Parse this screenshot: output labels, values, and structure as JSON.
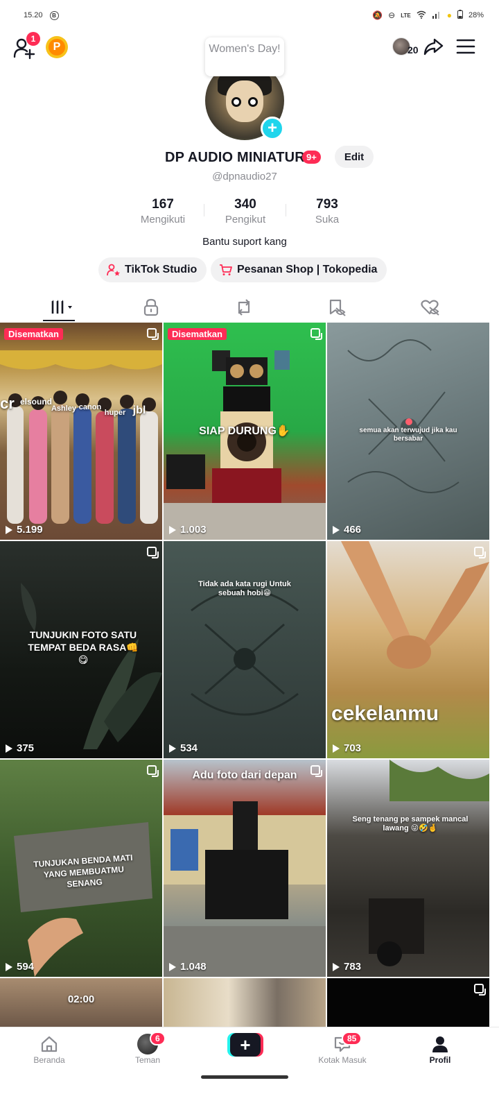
{
  "status_bar": {
    "time": "15.20",
    "carrier_icon": "B",
    "network": "LTE",
    "battery": "28%"
  },
  "top_bar": {
    "notification_count": "1",
    "friends_count": "20"
  },
  "tooltip": {
    "text": "Women's Day!"
  },
  "profile": {
    "name": "DP AUDIO MINIATUR",
    "name_badge": "9+",
    "edit_label": "Edit",
    "username": "@dpnaudio27",
    "bio": "Bantu suport kang"
  },
  "stats": [
    {
      "value": "167",
      "label": "Mengikuti"
    },
    {
      "value": "340",
      "label": "Pengikut"
    },
    {
      "value": "793",
      "label": "Suka"
    }
  ],
  "pills": [
    {
      "label": "TikTok Studio",
      "icon": "person-star-icon"
    },
    {
      "label": "Pesanan Shop | Tokopedia",
      "icon": "cart-icon"
    }
  ],
  "tabs": [
    "videos-grid-icon",
    "lock-icon",
    "repost-icon",
    "bookmark-eye-icon",
    "heart-eye-icon"
  ],
  "videos": [
    {
      "views": "5.199",
      "pinned": "Disematkan",
      "caption": "",
      "bg": "#c0a26b"
    },
    {
      "views": "1.003",
      "pinned": "Disematkan",
      "caption": "SIAP DURUNG✋",
      "bg": "#2fb54a"
    },
    {
      "views": "466",
      "pinned": "",
      "caption": "semua akan terwujud jika kau bersabar",
      "bg": "#6f7e7f"
    },
    {
      "views": "375",
      "pinned": "",
      "caption": "TUNJUKIN FOTO SATU TEMPAT BEDA RASA👊😋",
      "bg": "#1e2420"
    },
    {
      "views": "534",
      "pinned": "",
      "caption": "Tidak ada kata rugi Untuk sebuah hobi😁",
      "bg": "#3c4a48"
    },
    {
      "views": "703",
      "pinned": "",
      "caption": "cekelanmu",
      "bg": "#c9a36a"
    },
    {
      "views": "594",
      "pinned": "",
      "caption": "TUNJUKAN BENDA MATI YANG MEMBUATMU SENANG",
      "bg": "#4d6b35"
    },
    {
      "views": "1.048",
      "pinned": "",
      "caption": "Adu foto dari depan",
      "bg": "#7a8a95"
    },
    {
      "views": "783",
      "pinned": "",
      "caption": "Seng tenang pe sampek mancal lawang 😜🤣🤞",
      "bg": "#3d3a35"
    },
    {
      "views": "",
      "pinned": "",
      "caption": "02:00",
      "bg": "#8a7460"
    },
    {
      "views": "",
      "pinned": "",
      "caption": "",
      "bg": "#b8a488"
    },
    {
      "views": "",
      "pinned": "",
      "caption": "",
      "bg": "#050505"
    }
  ],
  "watermarks": {
    "v1_labels": [
      "cr",
      "elsound",
      "Ashley",
      "canon",
      "huper",
      "jbl"
    ]
  },
  "bottom_nav": [
    {
      "label": "Beranda",
      "badge": ""
    },
    {
      "label": "Teman",
      "badge": "6"
    },
    {
      "label": "",
      "badge": ""
    },
    {
      "label": "Kotak Masuk",
      "badge": "85"
    },
    {
      "label": "Profil",
      "badge": ""
    }
  ]
}
